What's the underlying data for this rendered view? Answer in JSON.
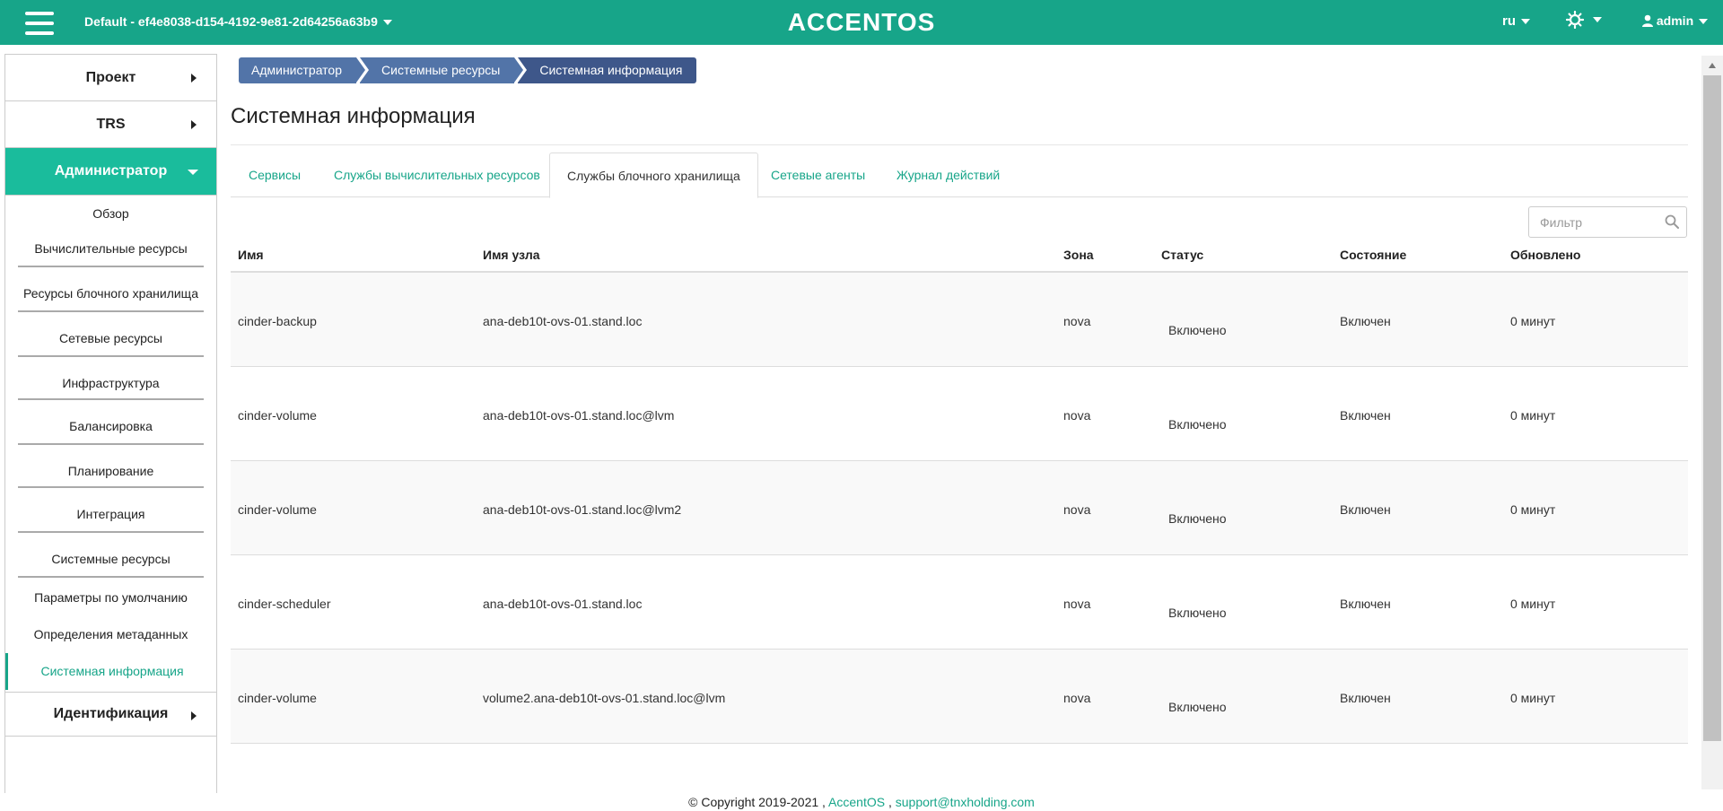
{
  "header": {
    "project": "Default - ef4e8038-d154-4192-9e81-2d64256a63b9",
    "logo": "ACCENTOS",
    "language": "ru",
    "user": "admin"
  },
  "sidebar": {
    "top": [
      {
        "label": "Проект"
      },
      {
        "label": "TRS"
      },
      {
        "label": "Администратор"
      }
    ],
    "admin_items": [
      {
        "label": "Обзор"
      },
      {
        "label": "Вычислительные ресурсы"
      },
      {
        "label": "Ресурсы блочного хранилища"
      },
      {
        "label": "Сетевые ресурсы"
      },
      {
        "label": "Инфраструктура"
      },
      {
        "label": "Балансировка"
      },
      {
        "label": "Планирование"
      },
      {
        "label": "Интеграция"
      },
      {
        "label": "Системные ресурсы"
      }
    ],
    "system_items": [
      {
        "label": "Параметры по умолчанию"
      },
      {
        "label": "Определения метаданных"
      },
      {
        "label": "Системная информация"
      }
    ],
    "bottom": {
      "label": "Идентификация"
    }
  },
  "breadcrumb": [
    "Администратор",
    "Системные ресурсы",
    "Системная информация"
  ],
  "page_title": "Системная информация",
  "tabs": [
    {
      "label": "Сервисы"
    },
    {
      "label": "Службы вычислительных ресурсов"
    },
    {
      "label": "Службы блочного хранилища"
    },
    {
      "label": "Сетевые агенты"
    },
    {
      "label": "Журнал действий"
    }
  ],
  "filter": {
    "placeholder": "Фильтр"
  },
  "table": {
    "headers": {
      "name": "Имя",
      "host": "Имя узла",
      "zone": "Зона",
      "status": "Статус",
      "state": "Состояние",
      "updated": "Обновлено"
    },
    "rows": [
      {
        "name": "cinder-backup",
        "host": "ana-deb10t-ovs-01.stand.loc",
        "zone": "nova",
        "status": "Включено",
        "state": "Включен",
        "updated": "0 минут"
      },
      {
        "name": "cinder-volume",
        "host": "ana-deb10t-ovs-01.stand.loc@lvm",
        "zone": "nova",
        "status": "Включено",
        "state": "Включен",
        "updated": "0 минут"
      },
      {
        "name": "cinder-volume",
        "host": "ana-deb10t-ovs-01.stand.loc@lvm2",
        "zone": "nova",
        "status": "Включено",
        "state": "Включен",
        "updated": "0 минут"
      },
      {
        "name": "cinder-scheduler",
        "host": "ana-deb10t-ovs-01.stand.loc",
        "zone": "nova",
        "status": "Включено",
        "state": "Включен",
        "updated": "0 минут"
      },
      {
        "name": "cinder-volume",
        "host": "volume2.ana-deb10t-ovs-01.stand.loc@lvm",
        "zone": "nova",
        "status": "Включено",
        "state": "Включен",
        "updated": "0 минут"
      }
    ]
  },
  "footer": {
    "copyright": "© Copyright 2019-2021 ,",
    "link1": "AccentOS",
    "sep": ",",
    "link2": "support@tnxholding.com"
  }
}
